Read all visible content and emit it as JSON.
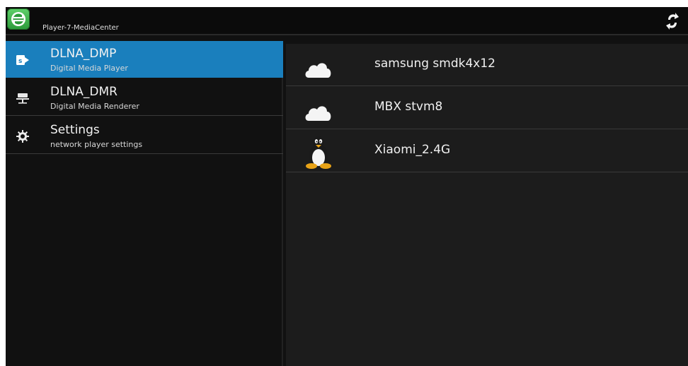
{
  "app": {
    "title": "Player-7-MediaCenter",
    "icon": "app-logo-icon",
    "accent": "#1a7fbd"
  },
  "actionbar": {
    "refresh_icon": "refresh-icon"
  },
  "menu": {
    "items": [
      {
        "title": "DLNA_DMP",
        "subtitle": "Digital Media Player",
        "icon": "dmp-icon",
        "selected": true
      },
      {
        "title": "DLNA_DMR",
        "subtitle": "Digital Media Renderer",
        "icon": "renderer-icon",
        "selected": false
      },
      {
        "title": "Settings",
        "subtitle": "network player settings",
        "icon": "gear-icon",
        "selected": false
      }
    ]
  },
  "devices": [
    {
      "name": "samsung smdk4x12",
      "icon": "cloud-icon"
    },
    {
      "name": "MBX stvm8",
      "icon": "cloud-icon"
    },
    {
      "name": "Xiaomi_2.4G",
      "icon": "linux-penguin-icon"
    }
  ]
}
